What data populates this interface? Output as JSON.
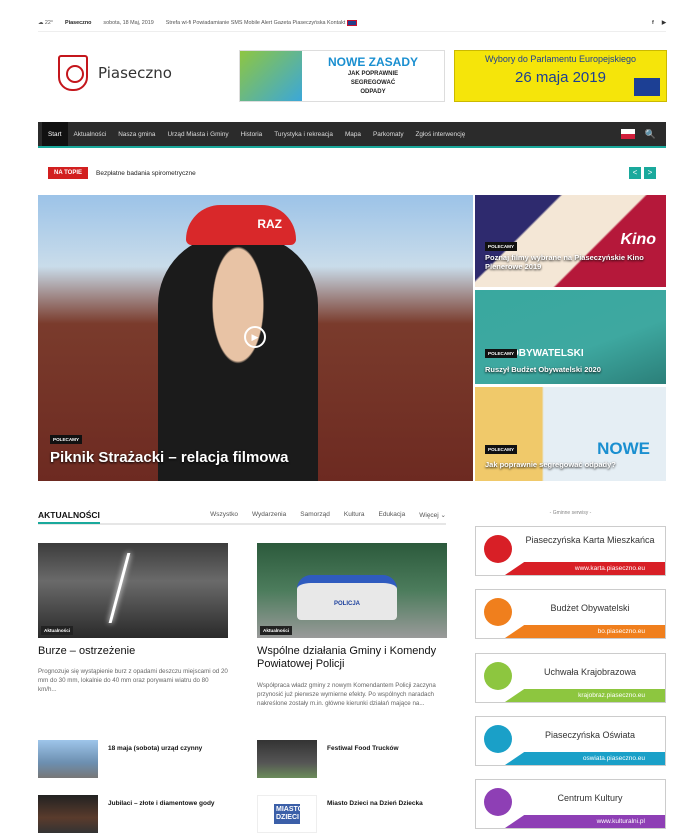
{
  "topbar": {
    "weather": "☁ 22°",
    "city": "Piaseczno",
    "date": "sobota, 18 Maj, 2019",
    "links": [
      "Strefa wi-fi",
      "Powiadamianie SMS",
      "Mobile Alert",
      "Gazeta Piaseczyńska",
      "Kontakt"
    ],
    "social": [
      "f",
      "▶"
    ]
  },
  "logo": {
    "text": "Piaseczno"
  },
  "banner1": {
    "title": "NOWE ZASADY",
    "line1": "JAK POPRAWNIE",
    "line2": "SEGREGOWAĆ",
    "line3": "ODPADY"
  },
  "banner2": {
    "title": "Wybory do Parlamentu Europejskiego",
    "date": "26 maja 2019"
  },
  "nav": {
    "items": [
      "Start",
      "Aktualności",
      "Nasza gmina",
      "Urząd Miasta i Gminy",
      "Historia",
      "Turystyka i rekreacja",
      "Mapa",
      "Parkomaty",
      "Zgłoś interwencję"
    ],
    "search": "🔍"
  },
  "ticker": {
    "badge": "NA TOPIE",
    "text": "Bezpłatne badania spirometryczne",
    "prev": "<",
    "next": ">"
  },
  "hero": {
    "cap_text": "RAZ",
    "tag": "POLECAMY",
    "title": "Piknik Strażacki – relacja filmowa"
  },
  "side": [
    {
      "tag": "POLECAMY",
      "title": "Poznaj filmy wybrane na Piaseczyńskie Kino Plenerowe 2019",
      "color": "#b5183a",
      "art_text": "Kino"
    },
    {
      "tag": "POLECAMY",
      "title": "Ruszył Budżet Obywatelski 2020",
      "color": "#3ea8a0",
      "art_text": "OBYWATELSKI"
    },
    {
      "tag": "POLECAMY",
      "title": "Jak poprawnie segregować odpady?",
      "color": "#e5eef4",
      "art_text": "NOWE"
    }
  ],
  "news": {
    "heading": "AKTUALNOŚCI",
    "tabs": [
      "Wszystko",
      "Wydarzenia",
      "Samorząd",
      "Kultura",
      "Edukacja",
      "Więcej ⌄"
    ],
    "cards": [
      {
        "tag": "Aktualności",
        "title": "Burze – ostrzeżenie",
        "text": "Prognozuje się wystąpienie burz z opadami deszczu miejscami od 20 mm do 30 mm, lokalnie do 40 mm oraz porywami wiatru do 80 km/h..."
      },
      {
        "tag": "Aktualności",
        "title": "Wspólne działania Gminy i Komendy Powiatowej Policji",
        "text": "Współpraca władz gminy z nowym Komendantem Policji zaczyna przynosić już pierwsze wymierne efekty. Po wspólnych naradach nakreślone zostały m.in. główne kierunki działań mające na..."
      }
    ],
    "small": [
      {
        "title": "18 maja (sobota) urząd czynny"
      },
      {
        "title": "Festiwal Food Trucków"
      },
      {
        "title": "Jubilaci – złote i diamentowe gody"
      },
      {
        "title": "Miasto Dzieci na Dzień Dziecka"
      }
    ],
    "police_text": "POLICJA",
    "miasto_text": "MIASTO DZIECI"
  },
  "services": {
    "label": "- Gminne serwisy -",
    "items": [
      {
        "name": "Piaseczyńska Karta Mieszkańca",
        "url": "www.karta.piaseczno.eu",
        "color": "#d81f26"
      },
      {
        "name": "Budżet Obywatelski",
        "url": "bo.piaseczno.eu",
        "color": "#f07f1d"
      },
      {
        "name": "Uchwała Krajobrazowa",
        "url": "krajobraz.piaseczno.eu",
        "color": "#8dc63f"
      },
      {
        "name": "Piaseczyńska Oświata",
        "url": "oswiata.piaseczno.eu",
        "color": "#1aa0c8"
      },
      {
        "name": "Centrum Kultury",
        "url": "www.kulturalni.pl",
        "color": "#8e3fb5"
      }
    ]
  }
}
